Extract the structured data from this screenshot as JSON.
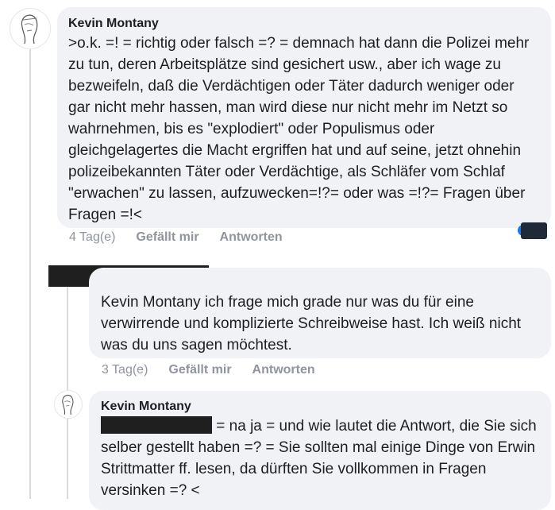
{
  "comments": [
    {
      "author": "Kevin Montany",
      "text": ">o.k. =! = richtig oder falsch =? = demnach  hat dann die Polizei mehr zu tun, deren Arbeitsplätze sind gesichert usw., aber ich wage zu bezweifeln, daß die Verdächtigen oder Täter dadurch weniger oder gar nicht mehr hassen, man wird diese nur nicht mehr im Netzt so wahrnehmen, bis es \"explodiert\" oder Populismus oder gleichgelagertes die Macht ergriffen hat und auf seine, jetzt ohnehin polizeibekannten Täter oder Verdächtige, als Schläfer vom Schlaf \"erwachen\" zu lassen, aufzuwecken=!?= oder was =!?= Fragen über Fragen =!<",
      "time": "4 Tag(e)",
      "like_label": "Gefällt mir",
      "reply_label": "Antworten"
    },
    {
      "author": "",
      "text": "Kevin Montany ich frage mich grade nur was du für eine verwirrende und komplizierte Schreibweise hast. Ich weiß nicht was du uns sagen möchtest.",
      "time": "3 Tag(e)",
      "like_label": "Gefällt mir",
      "reply_label": "Antworten"
    },
    {
      "author": "Kevin Montany",
      "text_after_redaction": " = na ja = und wie lautet die Antwort, die Sie sich selber gestellt haben =? = Sie sollten mal einige Dinge von Erwin Strittmatter ff. lesen, da dürften Sie vollkommen in Fragen versinken =? <"
    }
  ],
  "colors": {
    "bubble": "#f0f2f5",
    "meta_text": "#90949c",
    "redaction": "#1f1f1f"
  }
}
